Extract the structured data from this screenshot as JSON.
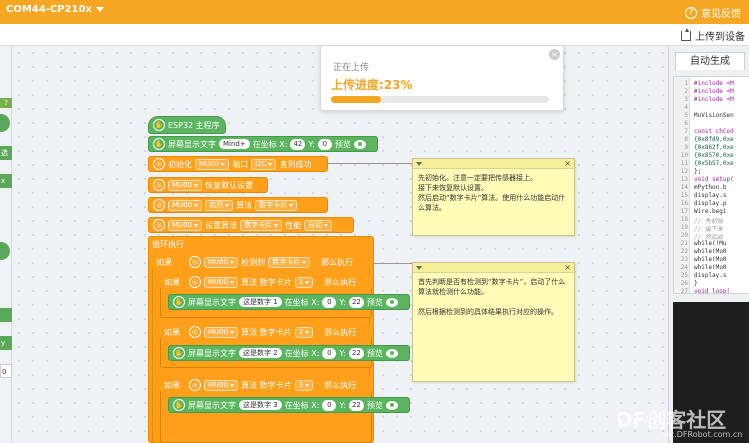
{
  "topbar": {
    "port": "COM44-CP210x",
    "feedback": "意见反馈"
  },
  "toolbar": {
    "upload": "上传到设备"
  },
  "flyout": {
    "badge": "?",
    "items": [
      "选",
      "x",
      "",
      "y",
      "0"
    ]
  },
  "progress": {
    "status": "正在上传",
    "text": "上传进度:23%",
    "percent": 23
  },
  "blocks": {
    "main_hat": "ESP32 主程序",
    "screen_text": "屏幕显示文字",
    "mindplus": "Mind+",
    "at_x": "在坐标 X:",
    "y": "Y:",
    "preview": "预览",
    "x42": "42",
    "y0": "0",
    "init": "初始化",
    "mu00": "MU00",
    "port_label": "端口",
    "i2c": "I2C",
    "until_ok": "直到成功",
    "restore": "恢复默认设置",
    "enable": "启用",
    "algo": "算法",
    "digit_card": "数字卡片",
    "set_algo": "设置算法",
    "performance": "性能",
    "auto": "自动",
    "loop": "循环执行",
    "if": "如果",
    "detected": "检测到",
    "then": "那么执行",
    "algo_digit": "算法 数字卡片",
    "is_digit1": "这是数字 1",
    "is_digit2": "这是数字 2",
    "is_digit3": "这是数字 3",
    "n1": "1",
    "n2": "2",
    "n3": "3",
    "x0": "0",
    "y22": "22"
  },
  "notes": {
    "note1": "先初始化。注意一定要把传感器接上。\n接下来恢复默认设置。\n然后启动“数字卡片”算法。使用什么功能启动什么算法。",
    "note2": "首先判断是否有检测到“数字卡片”，启动了什么算法就检测什么功能。\n\n然后根据检测到的具体结果执行对应的操作。"
  },
  "right_panel": {
    "tab": "自动生成",
    "line_numbers": [
      "1",
      "2",
      "3",
      "4",
      "5",
      "6",
      "7",
      "8",
      "9",
      "10",
      "11",
      "12",
      "13",
      "14",
      "15",
      "16",
      "17",
      "18",
      "19",
      "20",
      "21",
      "22",
      "23",
      "24",
      "25",
      "26",
      "27"
    ],
    "code_lines": [
      "#include <M",
      "#include <M",
      "#include <M",
      "",
      "MuVisionSen",
      "",
      "const chCod",
      "{0x8fd9,0xe",
      "{0x862f,0xe",
      "{0x8570,0xe",
      "{0x5b57,0xe",
      "};",
      "void setup(",
      "  mPython.b",
      "  display.s",
      "  display.p",
      "  Wire.begi",
      "  // 先初始",
      "  // 接下来",
      "  // 然后启",
      "  while(!Mu",
      "  while(Mu0",
      "  while(Mu0",
      "  while(Mu0",
      "  display.s",
      "}",
      "void loop("
    ]
  },
  "watermark": {
    "main": "DF创客社区",
    "sub": "mc.DFRobot.com.cn"
  },
  "colors": {
    "accent": "#f5a623",
    "block_green": "#5bb55f",
    "block_orange": "#ff9f1a",
    "note_bg": "#fffcb8"
  }
}
